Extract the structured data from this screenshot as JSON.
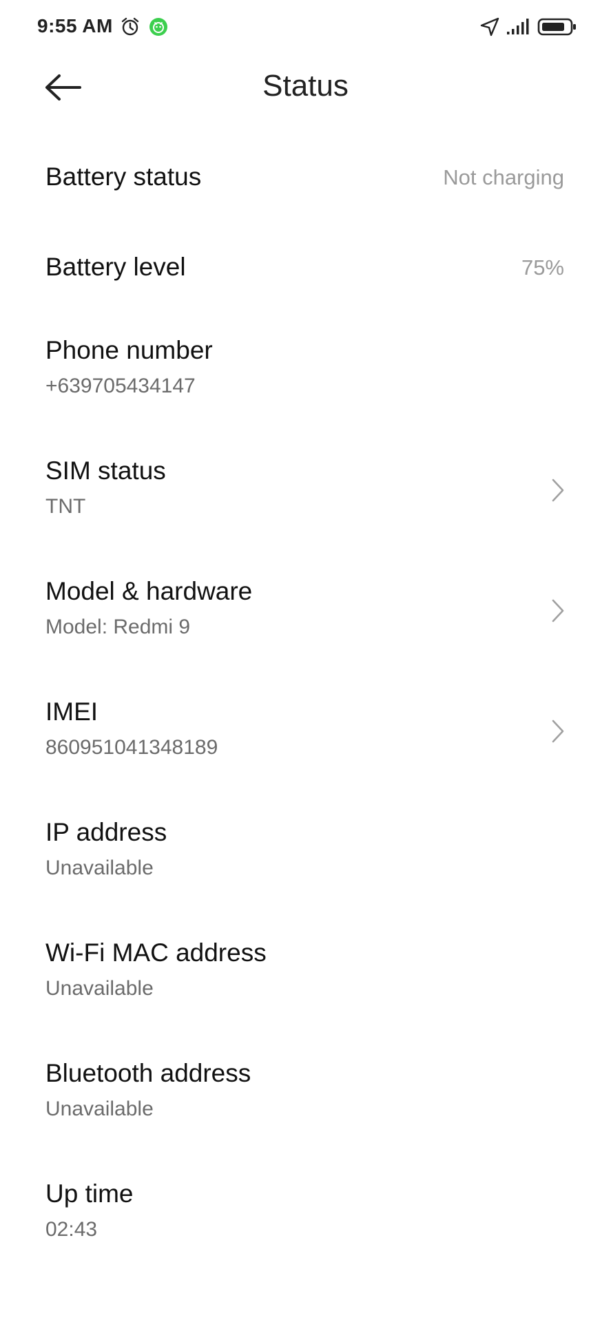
{
  "status_bar": {
    "time": "9:55 AM",
    "icons": [
      "alarm-icon",
      "app-notification-icon",
      "location-icon",
      "signal-icon",
      "battery-icon"
    ]
  },
  "header": {
    "title": "Status",
    "back_icon": "back-arrow-icon"
  },
  "items": [
    {
      "title": "Battery status",
      "value": "Not charging"
    },
    {
      "title": "Battery level",
      "value": "75%"
    },
    {
      "title": "Phone number",
      "subtitle": "+639705434147"
    },
    {
      "title": "SIM status",
      "subtitle": "TNT",
      "chevron": true
    },
    {
      "title": "Model & hardware",
      "subtitle": "Model: Redmi 9",
      "chevron": true
    },
    {
      "title": "IMEI",
      "subtitle": "860951041348189",
      "chevron": true
    },
    {
      "title": "IP address",
      "subtitle": "Unavailable"
    },
    {
      "title": "Wi-Fi MAC address",
      "subtitle": "Unavailable"
    },
    {
      "title": "Bluetooth address",
      "subtitle": "Unavailable"
    },
    {
      "title": "Up time",
      "subtitle": "02:43"
    }
  ],
  "colors": {
    "app_icon_green": "#3ccf4e",
    "title_text": "#111111",
    "subtitle_text": "#6b6b6b",
    "value_text": "#9a9a9a"
  }
}
